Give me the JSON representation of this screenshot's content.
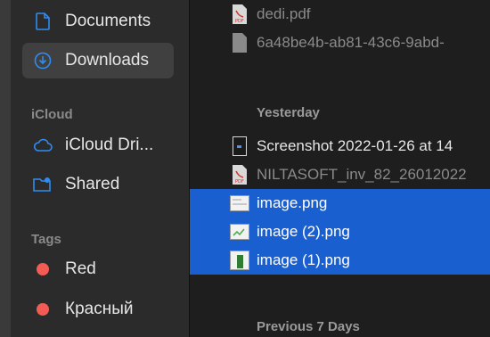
{
  "sidebar": {
    "favorites": [
      {
        "label": "Documents",
        "icon": "document-icon",
        "selected": false
      },
      {
        "label": "Downloads",
        "icon": "download-icon",
        "selected": true
      }
    ],
    "icloud_heading": "iCloud",
    "icloud": [
      {
        "label": "iCloud Dri...",
        "icon": "cloud-icon"
      },
      {
        "label": "Shared",
        "icon": "shared-folder-icon"
      }
    ],
    "tags_heading": "Tags",
    "tags": [
      {
        "label": "Red",
        "color": "#f25c54"
      },
      {
        "label": "Красный",
        "color": "#f25c54"
      }
    ]
  },
  "files": {
    "top": [
      {
        "name": "dedi.pdf",
        "icon": "pdf-icon",
        "dim": true
      },
      {
        "name": "6a48be4b-ab81-43c6-9abd-",
        "icon": "document-icon",
        "dim": true
      }
    ],
    "yesterday_heading": "Yesterday",
    "yesterday": [
      {
        "name": "Screenshot 2022-01-26 at 14",
        "icon": "screenshot-icon",
        "dim": false,
        "selected": false
      },
      {
        "name": "NILTASOFT_inv_82_26012022",
        "icon": "pdf-icon",
        "dim": true,
        "selected": false
      },
      {
        "name": "image.png",
        "icon": "image-icon",
        "dim": false,
        "selected": true
      },
      {
        "name": "image (2).png",
        "icon": "image-icon",
        "dim": false,
        "selected": true
      },
      {
        "name": "image (1).png",
        "icon": "image-icon",
        "dim": false,
        "selected": true
      }
    ],
    "previous_heading": "Previous 7 Days"
  },
  "colors": {
    "selection": "#1a5fd0",
    "accent": "#2f8cf2",
    "tag_red": "#f25c54"
  }
}
